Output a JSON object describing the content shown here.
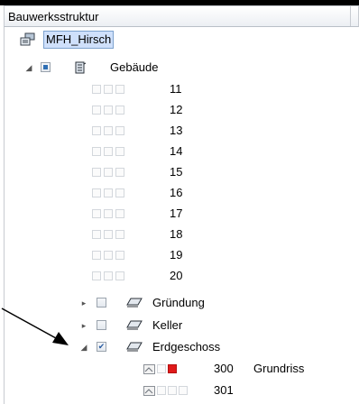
{
  "panel": {
    "title": "Bauwerksstruktur"
  },
  "tree": {
    "root": {
      "label": "MFH_Hirsch",
      "icon": "project-icon"
    },
    "building": {
      "label": "Gebäude",
      "icon": "building-icon"
    },
    "floors": [
      "11",
      "12",
      "13",
      "14",
      "15",
      "16",
      "17",
      "18",
      "19",
      "20"
    ],
    "levels": [
      {
        "label": "Gründung",
        "checked": false,
        "expanded": false
      },
      {
        "label": "Keller",
        "checked": false,
        "expanded": false
      },
      {
        "label": "Erdgeschoss",
        "checked": true,
        "expanded": true
      }
    ],
    "drawings": [
      {
        "number": "300",
        "name": "Grundriss"
      },
      {
        "number": "301",
        "name": ""
      }
    ]
  },
  "colors": {
    "accent": "#2f6fb4",
    "active_marker": "#e01a1a",
    "selection": "#cfe0fb"
  }
}
